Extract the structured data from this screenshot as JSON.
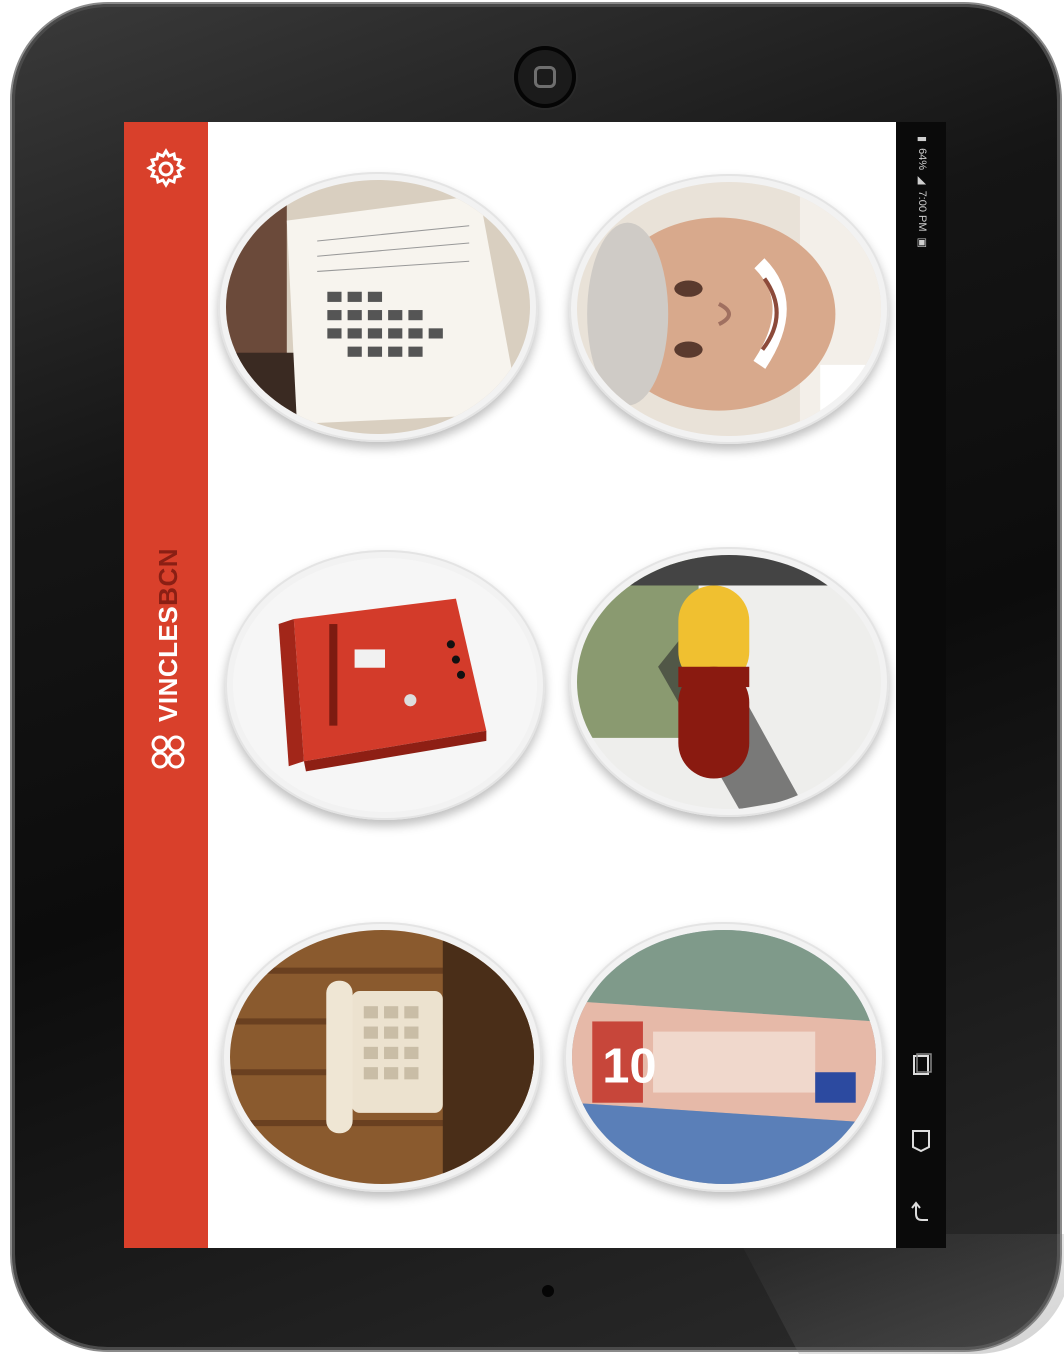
{
  "brand": {
    "name": "VINCLES",
    "suffix": "BCN"
  },
  "status_bar": {
    "time": "7:00 PM",
    "battery": "64%"
  },
  "colors": {
    "sidebar": "#d9402b",
    "system_bar": "#0a0a0a",
    "frame": "#151515"
  },
  "sidebar": {
    "settings_icon": "gear-icon",
    "logo_icon": "vincles-logo-icon"
  },
  "tiles": [
    {
      "name": "calendar",
      "icon": "calendar-photo"
    },
    {
      "name": "contacts",
      "icon": "elderly-man-photo"
    },
    {
      "name": "mailbox",
      "icon": "red-mailbox-photo"
    },
    {
      "name": "medication",
      "icon": "capsule-pill-photo"
    },
    {
      "name": "phone",
      "icon": "telephone-photo"
    },
    {
      "name": "money",
      "icon": "euro-banknotes-photo"
    }
  ],
  "banknote": {
    "denomination": "10"
  },
  "nav_buttons": [
    "recent-apps-icon",
    "home-icon",
    "back-icon"
  ]
}
